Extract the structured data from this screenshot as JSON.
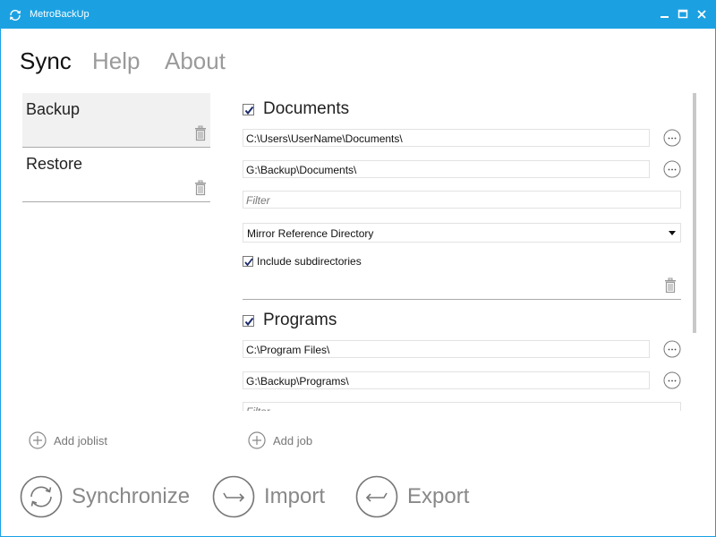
{
  "window": {
    "title": "MetroBackUp"
  },
  "tabs": [
    {
      "label": "Sync"
    },
    {
      "label": "Help"
    },
    {
      "label": "About"
    }
  ],
  "joblists": [
    {
      "label": "Backup",
      "selected": true
    },
    {
      "label": "Restore",
      "selected": false
    }
  ],
  "sidebar": {
    "add_joblist_label": "Add joblist"
  },
  "jobs": [
    {
      "label": "Documents",
      "checked": true,
      "source": "C:\\Users\\UserName\\Documents\\",
      "destination": "G:\\Backup\\Documents\\",
      "filter_placeholder": "Filter",
      "mode": "Mirror Reference Directory",
      "include_subdirs_label": "Include subdirectories",
      "include_subdirs": true
    },
    {
      "label": "Programs",
      "checked": true,
      "source": "C:\\Program Files\\",
      "destination": "G:\\Backup\\Programs\\",
      "filter_placeholder": "Filter"
    }
  ],
  "main": {
    "add_job_label": "Add job"
  },
  "actions": {
    "synchronize_label": "Synchronize",
    "import_label": "Import",
    "export_label": "Export"
  },
  "colors": {
    "accent": "#1ba1e2",
    "icon_gray": "#888888"
  },
  "icons": {
    "app": "sync-icon",
    "trash": "trash-icon",
    "browse": "ellipsis-icon",
    "add": "plus-circle-icon"
  }
}
